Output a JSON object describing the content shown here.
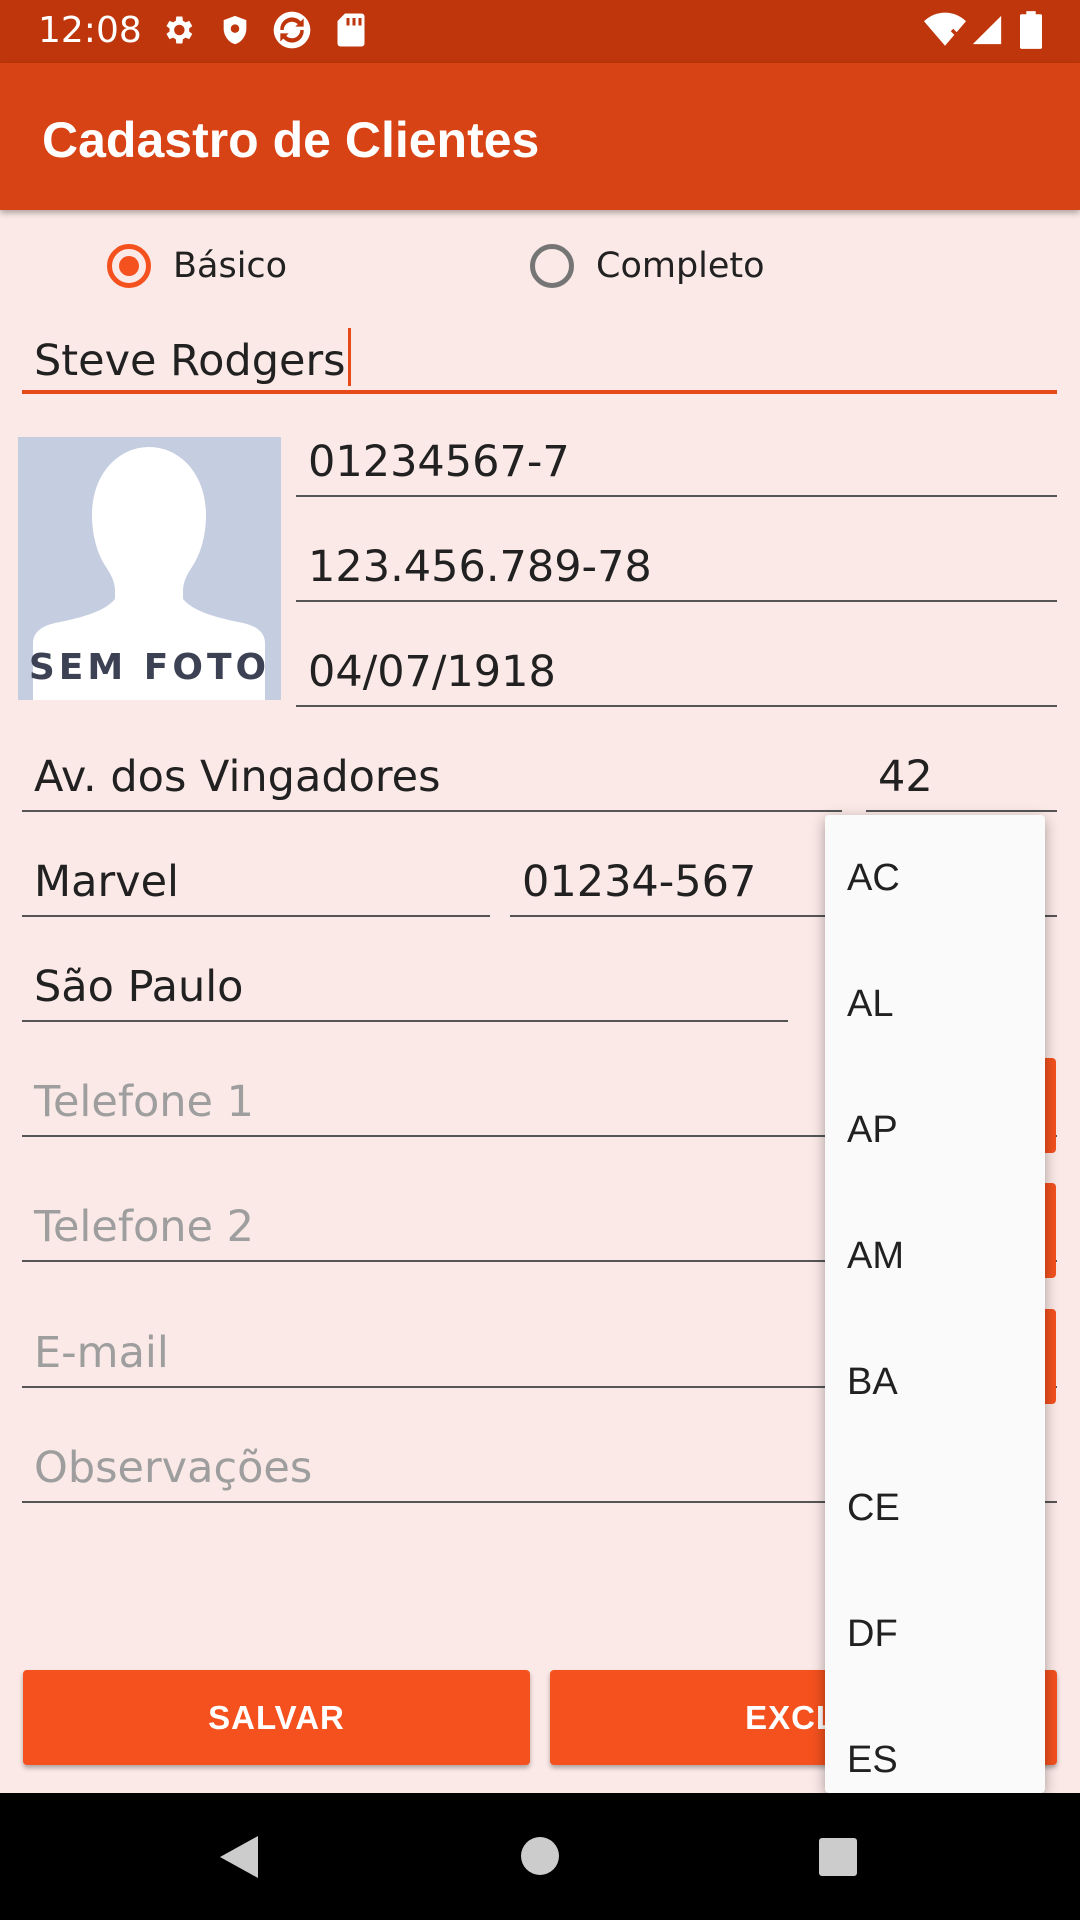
{
  "status_bar": {
    "time": "12:08",
    "left_icons": [
      "gear-icon",
      "shield-icon",
      "sync-icon",
      "sd-card-icon"
    ],
    "right_icons": [
      "wifi-icon",
      "signal-icon",
      "battery-icon"
    ]
  },
  "app_bar": {
    "title": "Cadastro de Clientes"
  },
  "colors": {
    "status": "#bf360c",
    "app_bar": "#d84315",
    "accent": "#f4511e",
    "background": "#fbe9e7"
  },
  "form": {
    "mode_options": [
      {
        "label": "Básico",
        "checked": true
      },
      {
        "label": "Completo",
        "checked": false
      }
    ],
    "name": "Steve Rodgers",
    "photo_label": "SEM FOTO",
    "rg": "01234567-7",
    "cpf": "123.456.789-78",
    "birth_date": "04/07/1918",
    "street": "Av. dos Vingadores",
    "number": "42",
    "neighborhood": "Marvel",
    "cep": "01234-567",
    "city": "São Paulo",
    "phone1_placeholder": "Telefone 1",
    "phone2_placeholder": "Telefone 2",
    "email_placeholder": "E-mail",
    "notes_placeholder": "Observações"
  },
  "buttons": {
    "save": "SALVAR",
    "delete": "EXCLU"
  },
  "state_dropdown": {
    "options": [
      "AC",
      "AL",
      "AP",
      "AM",
      "BA",
      "CE",
      "DF",
      "ES"
    ]
  },
  "nav_bar": {
    "icons": [
      "back-icon",
      "home-icon",
      "recents-icon"
    ]
  }
}
